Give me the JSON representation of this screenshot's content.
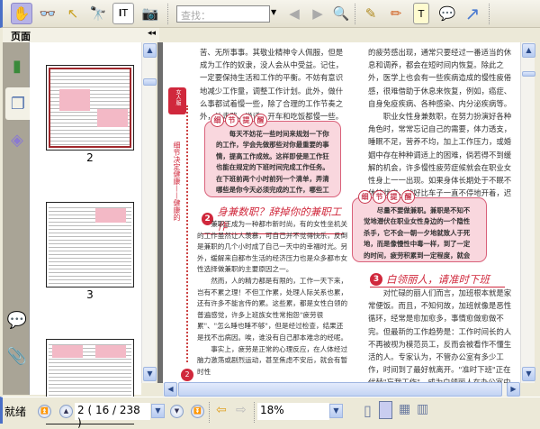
{
  "toolbar": {
    "tools": [
      {
        "name": "hand-tool",
        "icon": "✋"
      },
      {
        "name": "read-tool",
        "icon": "👓"
      },
      {
        "name": "select-tool",
        "icon": "↖"
      },
      {
        "name": "find-tool",
        "icon": "🔭"
      },
      {
        "name": "text-select-tool",
        "icon": "𝐈T"
      },
      {
        "name": "snapshot-tool",
        "icon": "📷"
      }
    ],
    "search_placeholder": "查找：",
    "annot_tools": [
      {
        "name": "highlight-tool",
        "icon": "✎"
      },
      {
        "name": "pencil-tool",
        "icon": "✏"
      },
      {
        "name": "textbox-tool",
        "icon": "T"
      },
      {
        "name": "note-tool",
        "icon": "💬"
      },
      {
        "name": "arrow-tool",
        "icon": "↗"
      }
    ]
  },
  "panel": {
    "title": "页面",
    "collapse": "◂◂",
    "thumbnails": [
      {
        "label": "2"
      },
      {
        "label": "3"
      }
    ]
  },
  "page": {
    "side_tab": "女人版",
    "side_text": "细节决定健康——健康的",
    "page_number": "2",
    "left_top": "苦、无所事事。其敬业精神令人佩服，但是成为工作的奴隶，没人会从中受益。记住，一定要保持生活和工作的平衡。不妨有意识地减少工作量，调整工作计划。此外，做什么事都试着慢一些，除了合理的工作节奏之外，让走路、说话、开车和吃饭都慢一些。",
    "tip_title": [
      "细",
      "节",
      "提",
      "醒"
    ],
    "tip1": "每天不妨花一些时间来规划一下你的工作，学会先做那些对你最重要的事情，提高工作成效。这样即使是工作狂也能在规定的下班时间完成工作任务。在下班前两个小时前列一个清单，弄清哪些是你今天必须完成的工作，哪些工作可以留待明天。这样你就有充足的时间来完成任务，从而减少工作之余的担心。",
    "heading2_num": "2",
    "heading2": "身兼数职？辞掉你的兼职工作",
    "left_p1": "兼职正成为一种都市新时尚，有的女性坐机关的工作虽然让人羡慕，可自己并不觉得快乐，反倒是兼职的几个小时成了自己一天中的幸福时光。另外，缓解来自都市生活的经济压力也是众多都市女性选择做兼职的主要原因之一。",
    "left_p2": "然而，人的精力都是有限的，工作一天下来，岂有不累之理！不但工作累，处理人际关系也累，还有许多不能言传的累。这些累，都是女性白领的普遍感觉，许多上班族女性常抱怨\"疲劳很累\"、\"怎么睡也睡不够\"，但是经过检查，结果还是找不出病因。唉，谁没有自己那本难念的经呢。",
    "left_p3": "事实上，疲劳是正常的心理反应，在人体经过脑力激荡或剧烈运动，甚至焦虑不安后，就会有暂时性",
    "right_p0": "的疲劳感出现，通常只要经过一番适当的休息和调养，都会在短时间内恢复。除此之外，医学上也会有一些疾病造成的慢性疲倦感，很难借助于休息来恢复，例如，癌症、自身免疫疾病、各种感染、内分泌疾病等。",
    "right_p1": "职业女性身兼数职，在努力扮演好各种角色时，常常忘记自己的需要，体力透支，睡眠不足，营养不均，加上工作压力，或婚姻中存在种种调适上的困难，倘若得不到缓解的机会，许多慢性疲劳症候就会在职业女性身上一一出现。如果身体长期处于不眠不休的状态，就好比车子一直不停地开着，迟早会出乱子。",
    "tip2": "尽量不要做兼职。兼职是不知不觉地潜伏在职业女性身边的一个隐性杀手，它不会一朝一夕地就致人于死地，而是像慢性中毒一样，到了一定的时间，疲劳积累到一定程度，就会引发疾病，这是必须引起职业女性重视的问题。",
    "heading3_num": "3",
    "heading3": "白领丽人，请准时下班",
    "right_p2": "对忙碌的丽人们而言，加班根本就是家常便饭。而且，不知何故，加班就像是恶性循环，经常是愈加愈多，事情愈做愈做不完。但最新的工作趋势是：工作时间长的人不再被视为模范员工，反而会被看作不懂生活的人。专家认为，不管办公室有多少工作，时间到了最好就离开。\"准时下班\"正在代替\"忘我工作\"，成为白领丽人在办公室中的新流行。"
  },
  "status": {
    "ready": "就绪",
    "page_field": "2 ( 16 / 238 )",
    "zoom": "18%"
  }
}
